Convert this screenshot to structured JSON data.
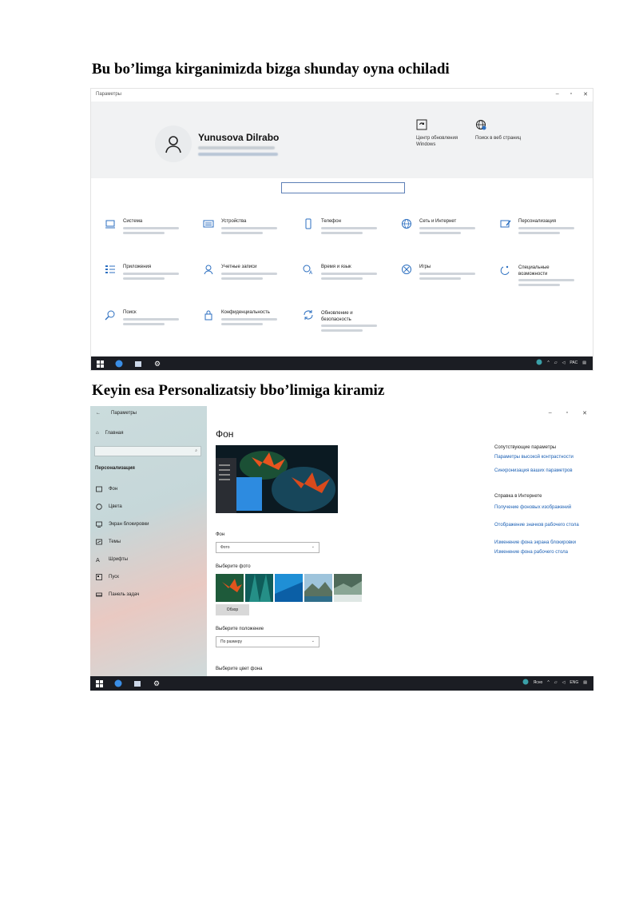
{
  "headings": {
    "first": "Bu bo’limga kirganimizda bizga shunday oyna ochiladi",
    "second": "Keyin esa Personalizatsiy bbo’limiga kiramiz"
  },
  "settings_home": {
    "window_title": "Параметры",
    "user_name": "Yunusova Dilrabo",
    "quick_actions": [
      {
        "label": "Центр обновления Windows",
        "icon": "refresh-icon"
      },
      {
        "label": "Поиск в веб страниц",
        "icon": "globe-icon"
      }
    ],
    "categories": [
      {
        "label": "Система",
        "icon": "laptop-icon"
      },
      {
        "label": "Устройства",
        "icon": "keyboard-icon"
      },
      {
        "label": "Телефон",
        "icon": "phone-icon"
      },
      {
        "label": "Сеть и Интернет",
        "icon": "globe-icon"
      },
      {
        "label": "Персонализация",
        "icon": "paintbrush-icon"
      },
      {
        "label": "Приложения",
        "icon": "apps-list-icon"
      },
      {
        "label": "Учетные записи",
        "icon": "person-icon"
      },
      {
        "label": "Время и язык",
        "icon": "time-language-icon"
      },
      {
        "label": "Игры",
        "icon": "xbox-icon"
      },
      {
        "label": "Специальные возможности",
        "icon": "accessibility-icon"
      },
      {
        "label": "Поиск",
        "icon": "search-icon"
      },
      {
        "label": "Конфиденциальность",
        "icon": "lock-icon"
      },
      {
        "label": "Обновление и безопасность",
        "icon": "sync-icon"
      }
    ],
    "taskbar": {
      "language": "РАС"
    }
  },
  "personalization": {
    "window_title": "Параметры",
    "home_label": "Главная",
    "sidebar_section": "Персонализация",
    "sidebar_items": [
      {
        "label": "Фон",
        "icon": "picture-icon"
      },
      {
        "label": "Цвета",
        "icon": "palette-icon"
      },
      {
        "label": "Экран блокировки",
        "icon": "monitor-icon"
      },
      {
        "label": "Темы",
        "icon": "brush-icon"
      },
      {
        "label": "Шрифты",
        "icon": "font-icon"
      },
      {
        "label": "Пуск",
        "icon": "start-icon"
      },
      {
        "label": "Панель задач",
        "icon": "taskbar-icon"
      }
    ],
    "page_title": "Фон",
    "background_label": "Фон",
    "background_value": "Фото",
    "choose_photo_label": "Выберите фото",
    "browse_label": "Обзор",
    "fit_label": "Выберите положение",
    "fit_value": "По размеру",
    "color_label": "Выберите цвет фона",
    "related_header": "Сопутствующие параметры",
    "related_links": [
      "Параметры высокой контрастности",
      "Синхронизация ваших параметров"
    ],
    "help_header": "Справка в Интернете",
    "help_links": [
      "Получение фоновых изображений",
      "Отображение значков рабочего стола",
      "Изменение фона экрана блокировки",
      "Изменение фона рабочего стола"
    ],
    "taskbar": {
      "weather": "Ясно",
      "language": "ENG"
    }
  },
  "colors": {
    "taskbar": "#1b1d23",
    "accent": "#1a5fb4",
    "icon_blue": "#2c6fc0"
  }
}
